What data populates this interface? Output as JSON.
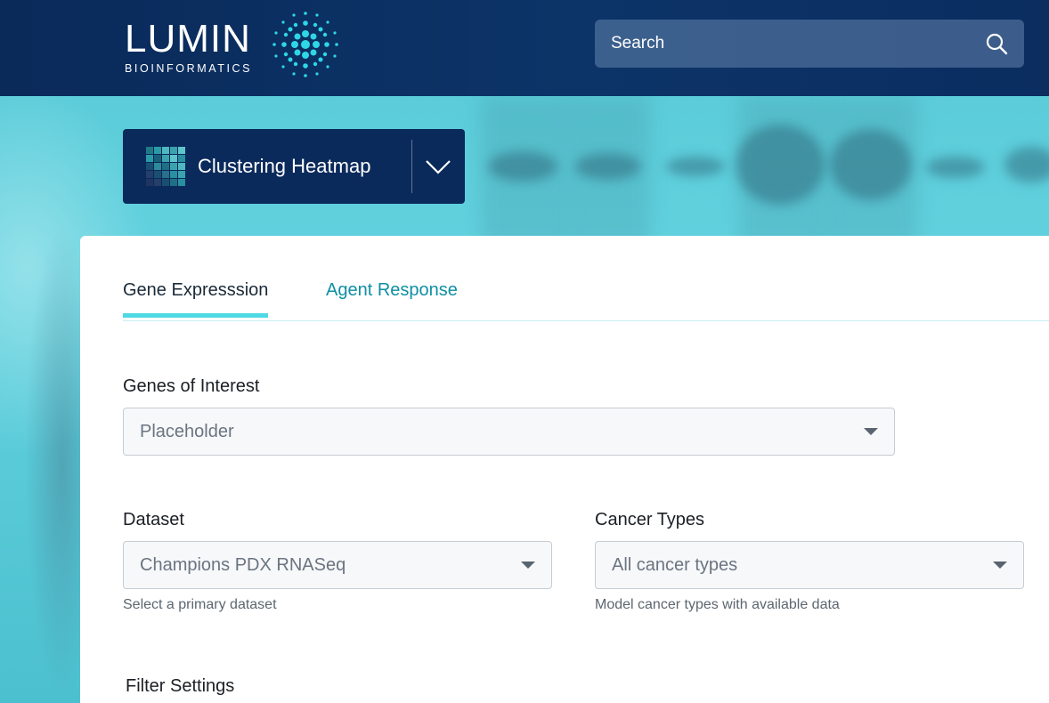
{
  "brand": {
    "name": "LUMIN",
    "tagline": "BIOINFORMATICS"
  },
  "search": {
    "placeholder": "Search"
  },
  "tool_selector": {
    "label": "Clustering Heatmap"
  },
  "tabs": [
    {
      "label": "Gene Expresssion",
      "active": true
    },
    {
      "label": "Agent Response",
      "active": false
    }
  ],
  "form": {
    "genes": {
      "label": "Genes of Interest",
      "value": "Placeholder"
    },
    "dataset": {
      "label": "Dataset",
      "value": "Champions PDX RNASeq",
      "helper": "Select a primary dataset"
    },
    "cancer_types": {
      "label": "Cancer Types",
      "value": "All cancer types",
      "helper": "Model cancer types with available data"
    },
    "filter_settings": {
      "title": "Filter Settings"
    }
  },
  "colors": {
    "header_bg": "#0b2d60",
    "accent": "#4fd9e4",
    "tab_inactive": "#0f8fa3"
  }
}
